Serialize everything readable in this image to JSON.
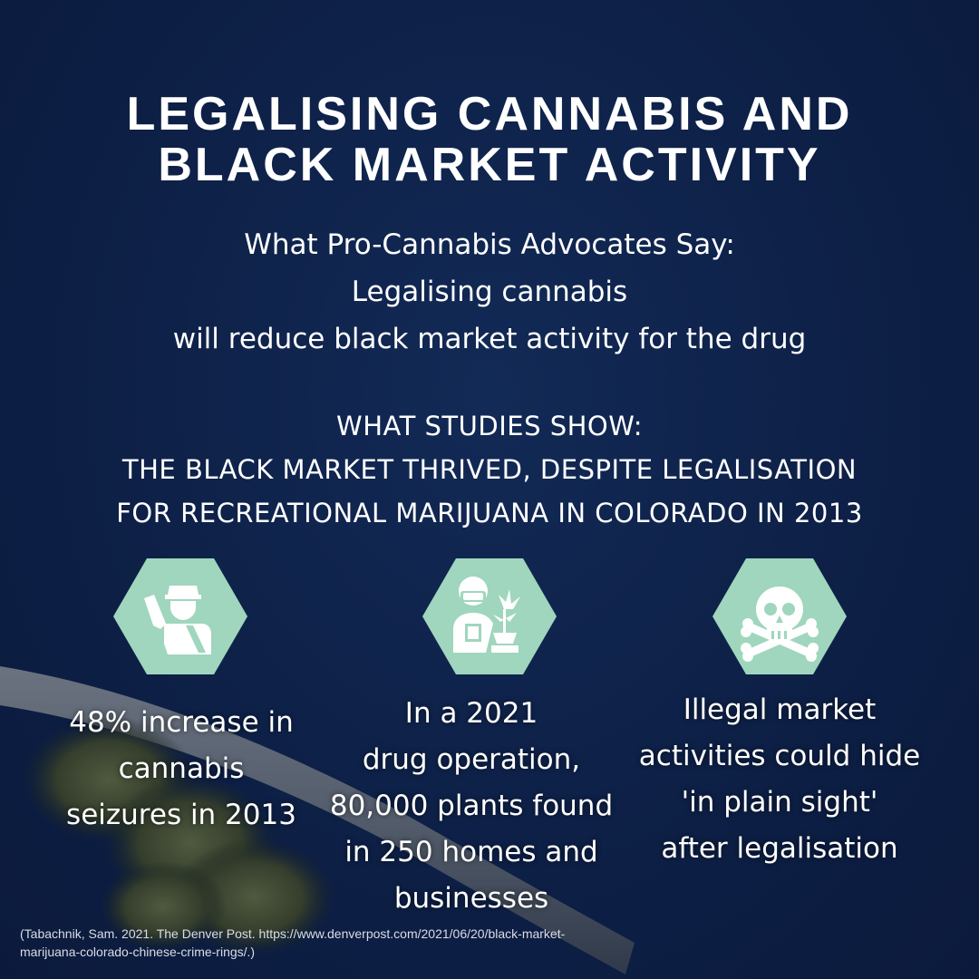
{
  "colors": {
    "background": "#0d1f45",
    "hexagon": "#9fd6bd",
    "icon": "#ffffff",
    "text": "#ffffff"
  },
  "title": {
    "line1": "LEGALISING CANNABIS AND",
    "line2": "BLACK MARKET ACTIVITY"
  },
  "advocates": {
    "line1": "What Pro-Cannabis Advocates Say:",
    "line2": "Legalising cannabis",
    "line3": "will reduce black market activity for the drug"
  },
  "studies": {
    "line1": "WHAT STUDIES SHOW:",
    "line2": "THE BLACK MARKET THRIVED, DESPITE LEGALISATION",
    "line3": "FOR RECREATIONAL MARIJUANA IN COLORADO IN 2013"
  },
  "stats": [
    {
      "icon": "police-officer-icon",
      "lines": [
        "48% increase in",
        "cannabis",
        "seizures in 2013"
      ]
    },
    {
      "icon": "plant-grower-icon",
      "lines": [
        "In a 2021",
        "drug operation,",
        "80,000 plants found",
        "in 250 homes and",
        "businesses"
      ]
    },
    {
      "icon": "skull-crossbones-icon",
      "lines": [
        "Illegal market",
        "activities could hide",
        "'in plain sight'",
        "after legalisation"
      ]
    }
  ],
  "citation": {
    "line1": "(Tabachnik, Sam. 2021. The Denver Post. https://www.denverpost.com/2021/06/20/black-market-",
    "line2": "marijuana-colorado-chinese-crime-rings/.)"
  }
}
